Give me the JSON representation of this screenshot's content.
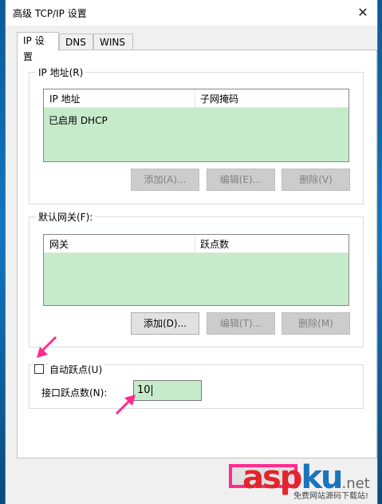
{
  "window": {
    "title": "高级 TCP/IP 设置"
  },
  "tabs": [
    {
      "label": "IP 设置",
      "active": true
    },
    {
      "label": "DNS",
      "active": false
    },
    {
      "label": "WINS",
      "active": false
    }
  ],
  "ip_group": {
    "label": "IP 地址(R)",
    "columns": [
      "IP 地址",
      "子网掩码"
    ],
    "rows": [
      [
        "已启用 DHCP",
        ""
      ]
    ],
    "buttons": {
      "add": "添加(A)...",
      "edit": "编辑(E)...",
      "delete": "删除(V)"
    }
  },
  "gateway_group": {
    "label": "默认网关(F):",
    "columns": [
      "网关",
      "跃点数"
    ],
    "rows": [],
    "buttons": {
      "add": "添加(D)...",
      "edit": "编辑(T)...",
      "delete": "删除(M)"
    }
  },
  "metric": {
    "auto_checkbox_label": "自动跃点(U)",
    "auto_checked": false,
    "interface_label": "接口跃点数(N):",
    "interface_value": "10"
  },
  "watermark": {
    "brand_asp": "asp",
    "brand_ku": "ku",
    "brand_net": ".net",
    "tagline": "免费网站源码下载站!"
  },
  "colors": {
    "highlight": "#c6ebca",
    "annotation": "#ff2b8f",
    "desktop": "#1277c0"
  }
}
